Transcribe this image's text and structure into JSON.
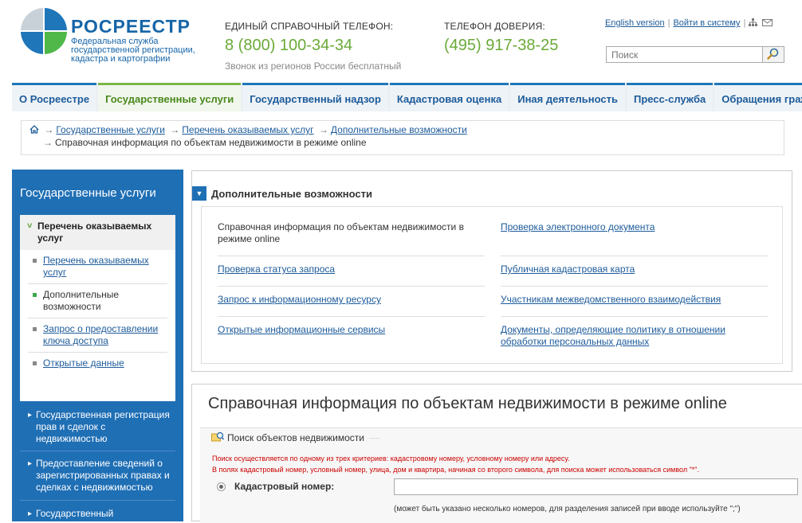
{
  "header": {
    "logo_title": "РОСРЕЕСТР",
    "logo_subtitle": "Федеральная служба государственной регистрации, кадастра и картографии",
    "phone1_label": "ЕДИНЫЙ СПРАВОЧНЫЙ ТЕЛЕФОН:",
    "phone1_number": "8 (800) 100-34-34",
    "phone1_note": "Звонок из регионов России бесплатный",
    "phone2_label": "ТЕЛЕФОН ДОВЕРИЯ:",
    "phone2_number": "(495) 917-38-25",
    "english_link": "English version",
    "login_link": "Войти в систему",
    "search_placeholder": "Поиск"
  },
  "nav": {
    "items": [
      {
        "label": "О Росреестре"
      },
      {
        "label": "Государственные услуги"
      },
      {
        "label": "Государственный надзор"
      },
      {
        "label": "Кадастровая оценка"
      },
      {
        "label": "Иная деятельность"
      },
      {
        "label": "Пресс-служба"
      },
      {
        "label": "Обращения граждан"
      }
    ]
  },
  "breadcrumb": {
    "items": [
      "Государственные услуги",
      "Перечень оказываемых услуг",
      "Дополнительные возможности"
    ],
    "current": "Справочная информация по объектам недвижимости в режиме online"
  },
  "sidebar": {
    "title": "Государственные услуги",
    "active_section": "Перечень оказываемых услуг",
    "sub_items": [
      {
        "label": "Перечень оказываемых услуг"
      },
      {
        "label": "Дополнительные возможности"
      },
      {
        "label": "Запрос о предоставлении ключа доступа"
      },
      {
        "label": "Открытые данные"
      }
    ],
    "links": [
      {
        "label": "Государственная регистрация прав и сделок с недвижимостью"
      },
      {
        "label": "Предоставление сведений о зарегистрированных правах и сделках с недвижимостью"
      },
      {
        "label": "Государственный"
      }
    ]
  },
  "extras": {
    "title": "Дополнительные возможности",
    "items": [
      {
        "label": "Справочная информация по объектам недвижимости в режиме online"
      },
      {
        "label": "Проверка электронного документа"
      },
      {
        "label": "Проверка статуса запроса"
      },
      {
        "label": "Публичная кадастровая карта"
      },
      {
        "label": "Запрос к информационному ресурсу"
      },
      {
        "label": "Участникам межведомственного взаимодействия"
      },
      {
        "label": "Открытые информационные сервисы"
      },
      {
        "label": "Документы, определяющие политику в отношении обработки персональных данных"
      }
    ]
  },
  "search_form": {
    "page_title": "Справочная информация по объектам недвижимости в режиме online",
    "legend": "Поиск объектов недвижимости",
    "warning1": "Поиск осуществляется по одному из трех критериев: кадастровому номеру, условному номеру или адресу.",
    "warning2": "В полях кадастровый номер, условный номер, улица, дом и квартира, начиная со второго символа, для поиска может использоваться символ \"*\".",
    "cadastral_label": "Кадастровый номер:",
    "cadastral_value": "",
    "cadastral_hint": "(может быть указано несколько номеров, для разделения записей при вводе используйте \";\")"
  },
  "colors": {
    "brand_blue": "#1f6fb5",
    "brand_green": "#6aaa38",
    "warning_red": "#cc0000"
  }
}
